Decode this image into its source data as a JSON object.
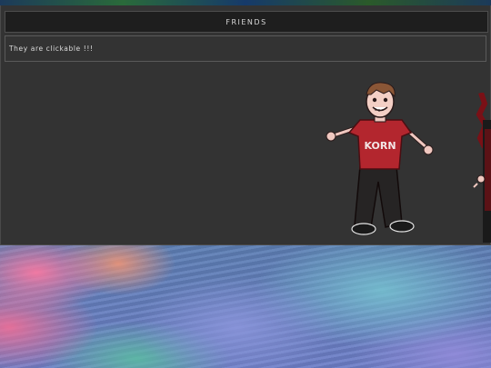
{
  "panel": {
    "title": "FRIENDS",
    "note": "They are clickable !!!"
  },
  "friends": [
    {
      "id": "friend-1",
      "shirt_text": "KORN",
      "icon": "character-icon"
    },
    {
      "id": "friend-2",
      "icon": "character-icon"
    }
  ],
  "colors": {
    "panel_bg": "#333333",
    "header_bg": "#1e1e1e",
    "shirt": "#b3262e",
    "text": "#dcdcdc"
  }
}
